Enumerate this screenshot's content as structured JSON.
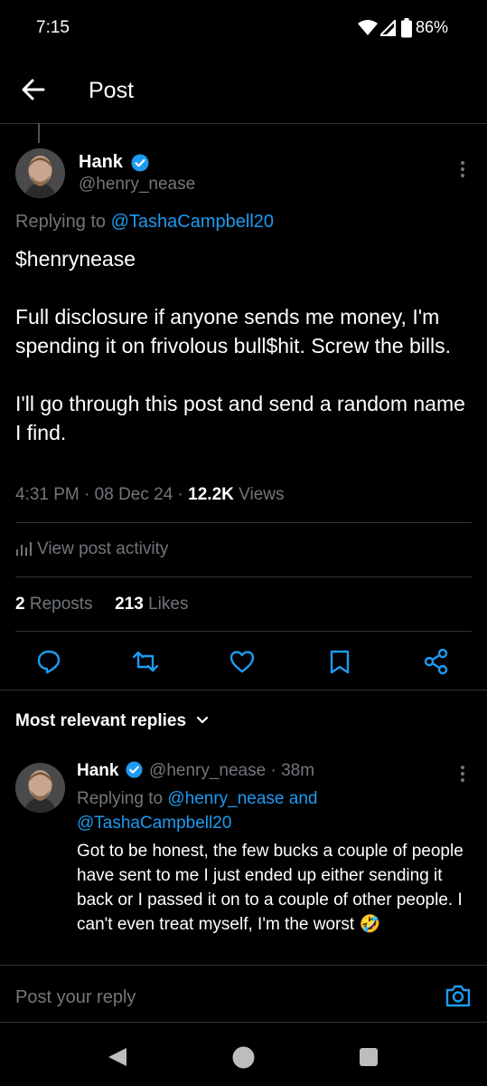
{
  "status": {
    "time": "7:15",
    "battery": "86%"
  },
  "header": {
    "title": "Post"
  },
  "post": {
    "author": "Hank",
    "handle": "@henry_nease",
    "replying_prefix": "Replying to",
    "replying_to": "@TashaCampbell20",
    "body": "$henrynease\n\nFull disclosure if anyone sends me money, I'm spending it on frivolous bull$hit. Screw the bills.\n\nI'll go through this post and send a random name I find.",
    "time": "4:31 PM",
    "date": "08 Dec 24",
    "views_count": "12.2K",
    "views_label": "Views",
    "activity": "View post activity",
    "reposts_count": "2",
    "reposts_label": "Reposts",
    "likes_count": "213",
    "likes_label": "Likes"
  },
  "replies_sort": "Most relevant replies",
  "reply": {
    "author": "Hank",
    "handle": "@henry_nease",
    "age": "· 38m",
    "replying_prefix": "Replying to",
    "replying_to1": "@henry_nease",
    "and": "and",
    "replying_to2": "@TashaCampbell20",
    "body": "Got to be honest, the few bucks a couple of people have sent to me I just ended up either sending it back or I passed it on to a couple of other people. I can't even treat myself, I'm the worst",
    "emoji": "🤣"
  },
  "composer": {
    "placeholder": "Post your reply"
  },
  "colors": {
    "accent": "#1d9bf0",
    "muted": "#71767b",
    "divider": "#2f3336"
  }
}
